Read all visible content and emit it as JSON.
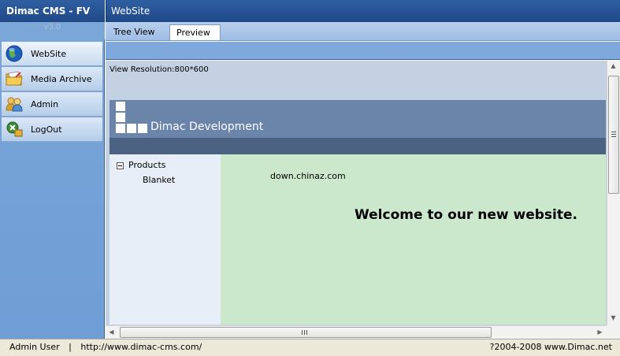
{
  "app": {
    "title": "Dimac CMS - FV",
    "version": "v3.0"
  },
  "sidebar": {
    "items": [
      {
        "label": "WebSite",
        "icon": "globe-icon"
      },
      {
        "label": "Media Archive",
        "icon": "folder-icon"
      },
      {
        "label": "Admin",
        "icon": "users-icon"
      },
      {
        "label": "LogOut",
        "icon": "logout-icon"
      }
    ]
  },
  "header": {
    "title": "WebSite"
  },
  "tabs": [
    {
      "label": "Tree View",
      "selected": false
    },
    {
      "label": "Preview",
      "selected": true
    }
  ],
  "preview": {
    "resolution": "View Resolution:800*600",
    "site": {
      "name": "Dimac Development",
      "tree": {
        "root": "Products",
        "child": "Blanket"
      },
      "text": "down.chinaz.com",
      "welcome": "Welcome to our new website."
    }
  },
  "footer": {
    "user": "Admin User",
    "separator": "|",
    "url": "http://www.dimac-cms.com/",
    "copyright": "?2004-2008 www.Dimac.net"
  },
  "colors": {
    "header_blue": "#1f4886",
    "sidebar_blue": "#7aa6d8",
    "site_header": "#6a85a9",
    "site_main": "#cce8cc"
  }
}
